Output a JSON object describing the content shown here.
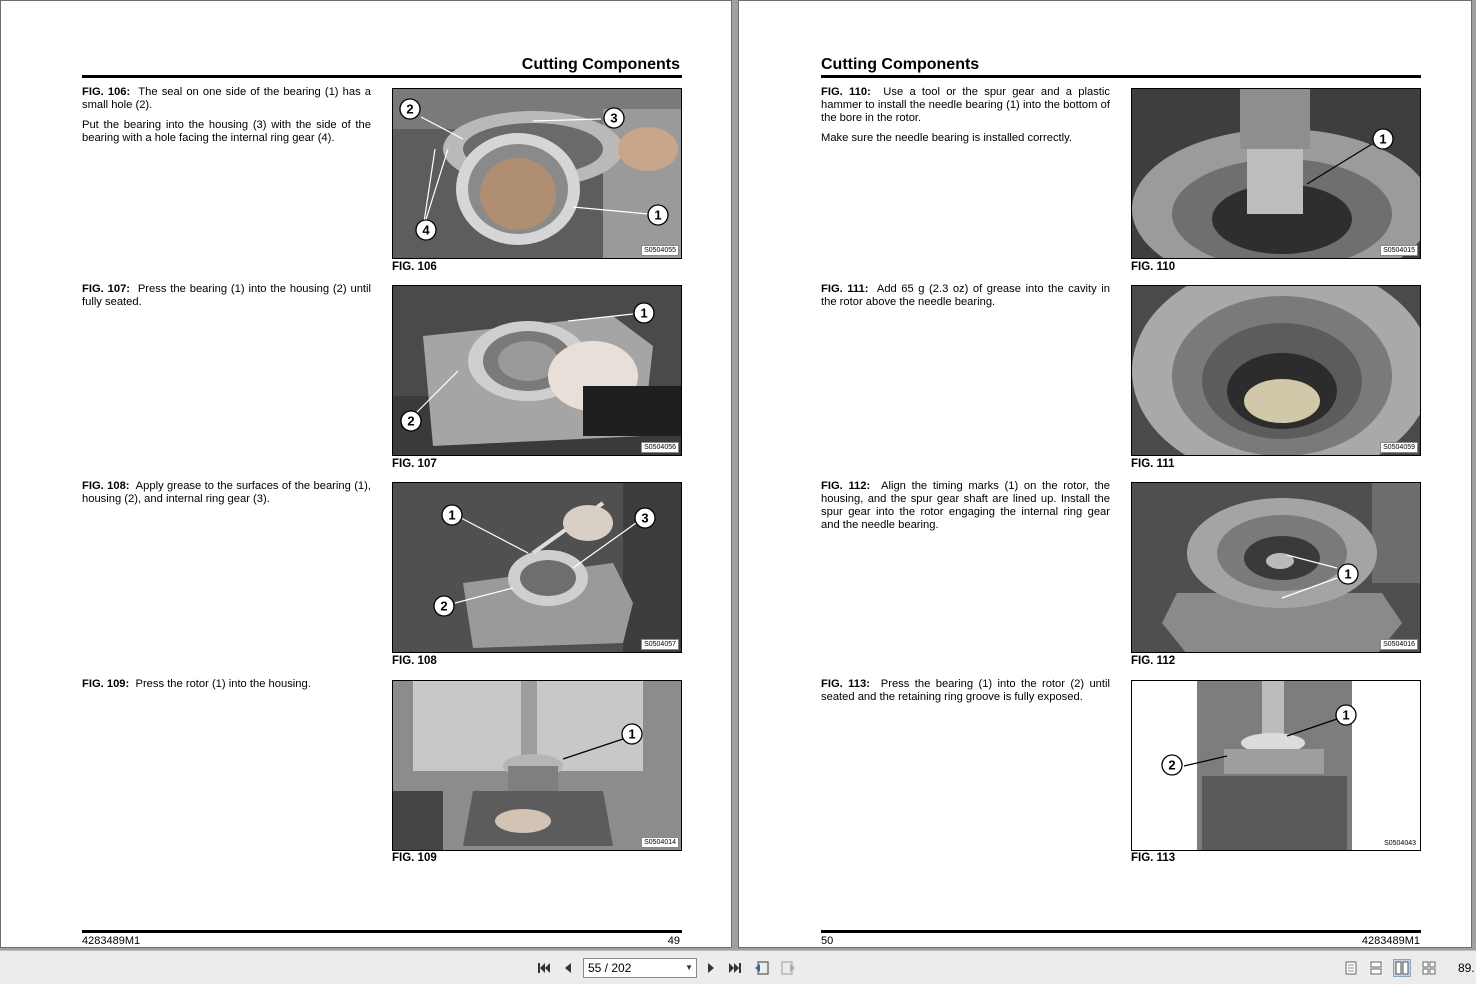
{
  "left_page": {
    "header": "Cutting Components",
    "footer_left": "4283489M1",
    "footer_right": "49",
    "items": [
      {
        "fig_label": "FIG. 106:",
        "paragraphs": [
          "The seal on one side of the bearing (1) has a small hole (2).",
          "Put the bearing into the housing (3) with the side of the bearing with a hole facing the internal ring gear (4)."
        ],
        "caption": "FIG. 106",
        "code": "S0504055",
        "callouts": [
          "2",
          "3",
          "1",
          "4"
        ]
      },
      {
        "fig_label": "FIG. 107:",
        "paragraphs": [
          "Press the bearing (1) into the housing (2) until fully seated."
        ],
        "caption": "FIG. 107",
        "code": "S0504056",
        "callouts": [
          "1",
          "2"
        ]
      },
      {
        "fig_label": "FIG. 108:",
        "paragraphs": [
          "Apply grease to the surfaces of the bearing (1), housing (2), and internal ring gear (3)."
        ],
        "caption": "FIG. 108",
        "code": "S0504057",
        "callouts": [
          "1",
          "3",
          "2"
        ]
      },
      {
        "fig_label": "FIG. 109:",
        "paragraphs": [
          "Press the rotor (1) into the housing."
        ],
        "caption": "FIG. 109",
        "code": "S0504014",
        "callouts": [
          "1"
        ]
      }
    ]
  },
  "right_page": {
    "header": "Cutting Components",
    "footer_left": "50",
    "footer_right": "4283489M1",
    "items": [
      {
        "fig_label": "FIG. 110:",
        "paragraphs": [
          "Use a tool or the spur gear and a plastic hammer to install the needle bearing (1) into the bottom of the bore in the rotor.",
          "Make sure the needle bearing is installed correctly."
        ],
        "caption": "FIG. 110",
        "code": "S0504015",
        "callouts": [
          "1"
        ]
      },
      {
        "fig_label": "FIG. 111:",
        "paragraphs": [
          "Add 65 g (2.3 oz) of grease into the cavity in the rotor above the needle bearing."
        ],
        "caption": "FIG. 111",
        "code": "S0504059",
        "callouts": []
      },
      {
        "fig_label": "FIG. 112:",
        "paragraphs": [
          "Align the timing marks (1) on the rotor, the housing, and the spur gear shaft are lined up. Install the spur gear into the rotor engaging the internal ring gear and the needle bearing."
        ],
        "caption": "FIG. 112",
        "code": "S0504016",
        "callouts": [
          "1"
        ]
      },
      {
        "fig_label": "FIG. 113:",
        "paragraphs": [
          "Press the bearing (1) into the rotor (2) until seated and the retaining ring groove is fully exposed."
        ],
        "caption": "FIG. 113",
        "code": "S0504043",
        "callouts": [
          "1",
          "2"
        ]
      }
    ]
  },
  "toolbar": {
    "page_indicator": "55 / 202",
    "zoom": "89."
  }
}
